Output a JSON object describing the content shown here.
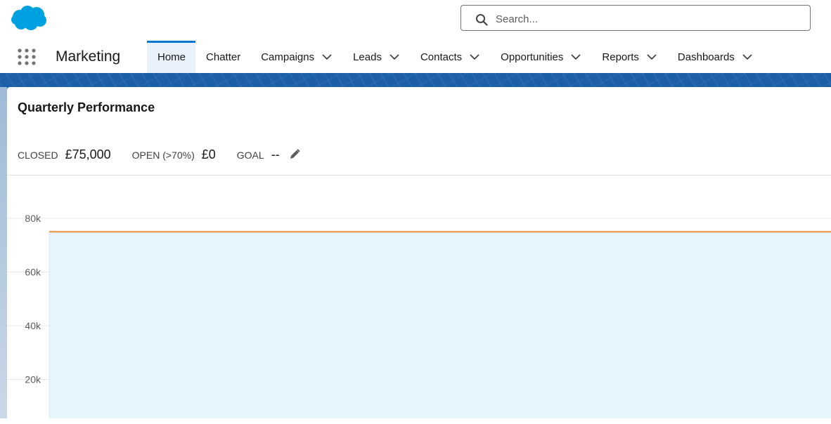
{
  "header": {
    "search": {
      "placeholder": "Search...",
      "value": ""
    }
  },
  "nav": {
    "app_name": "Marketing",
    "items": [
      {
        "label": "Home",
        "active": true,
        "dropdown": false
      },
      {
        "label": "Chatter",
        "active": false,
        "dropdown": false
      },
      {
        "label": "Campaigns",
        "active": false,
        "dropdown": true
      },
      {
        "label": "Leads",
        "active": false,
        "dropdown": true
      },
      {
        "label": "Contacts",
        "active": false,
        "dropdown": true
      },
      {
        "label": "Opportunities",
        "active": false,
        "dropdown": true
      },
      {
        "label": "Reports",
        "active": false,
        "dropdown": true
      },
      {
        "label": "Dashboards",
        "active": false,
        "dropdown": true
      }
    ]
  },
  "card": {
    "title": "Quarterly Performance",
    "metrics": {
      "closed_label": "CLOSED",
      "closed_value": "£75,000",
      "open_label": "OPEN (>70%)",
      "open_value": "£0",
      "goal_label": "GOAL",
      "goal_value": "--"
    }
  },
  "colors": {
    "brand": "#00a1e0",
    "accent": "#0176d3",
    "closed_line": "#e8a05a",
    "area_fill": "#e6f6fd"
  },
  "chart_data": {
    "type": "area",
    "y_tick_labels": [
      "80k",
      "60k",
      "40k",
      "20k"
    ],
    "y_ticks": [
      80000,
      60000,
      40000,
      20000
    ],
    "ylim": [
      0,
      80000
    ],
    "grid": true,
    "series": [
      {
        "name": "",
        "values": [
          75000,
          75000
        ]
      }
    ]
  }
}
